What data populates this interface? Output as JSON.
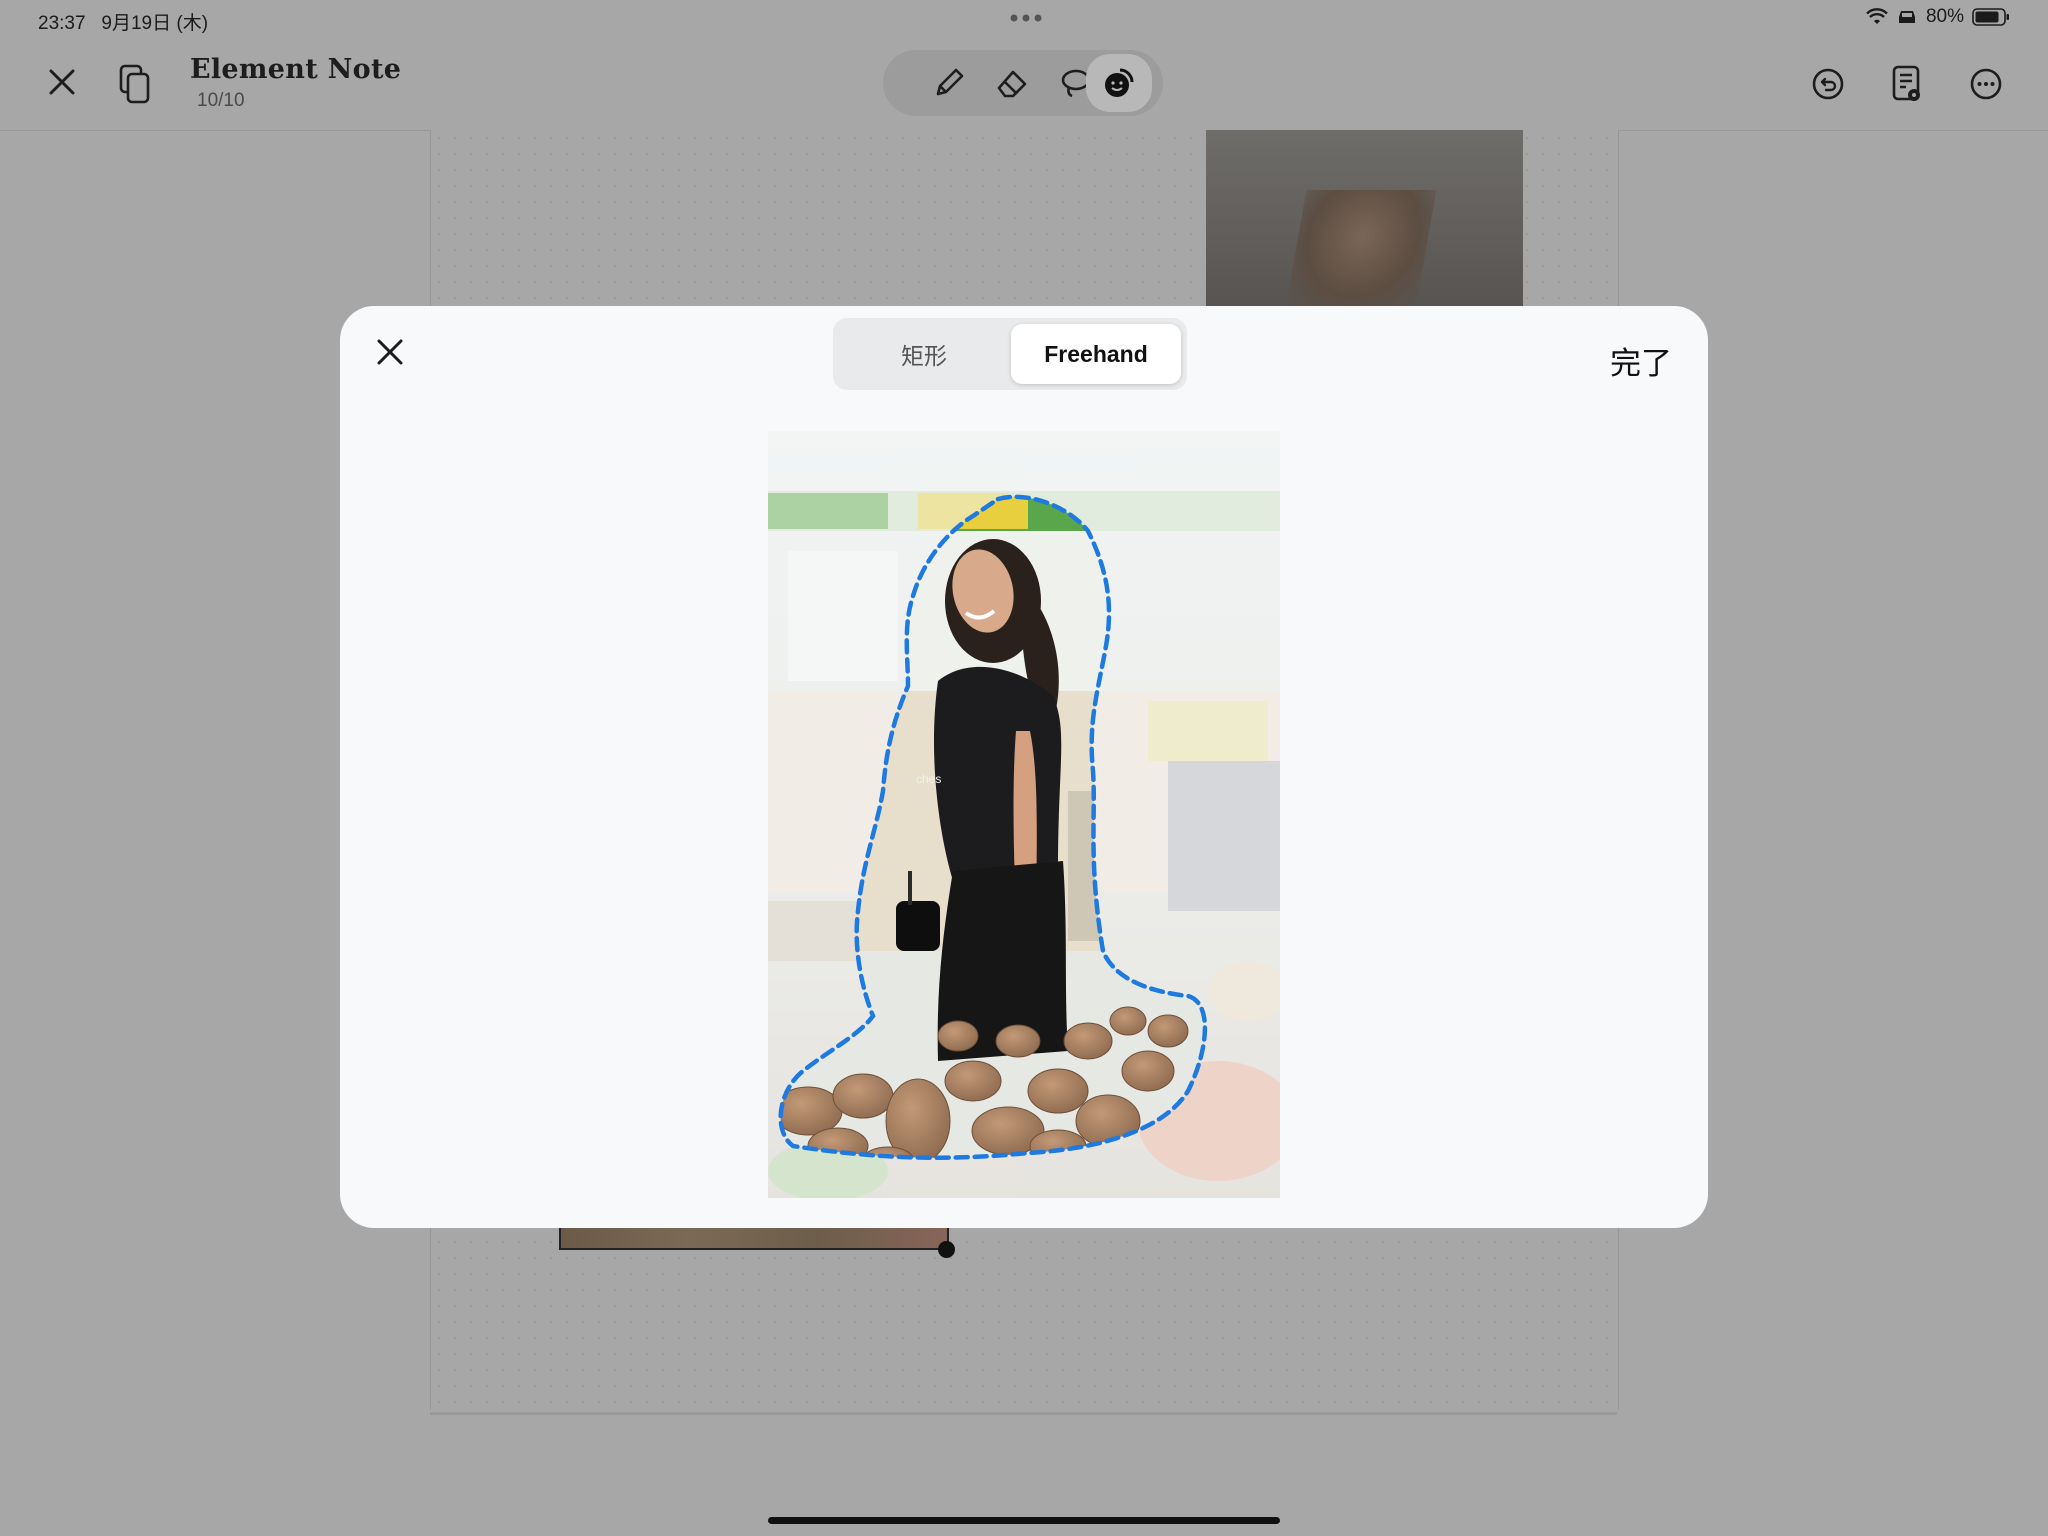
{
  "status_bar": {
    "time": "23:37",
    "date": "9月19日 (木)",
    "battery": "80%"
  },
  "document": {
    "title": "Element Note",
    "page": "10/10"
  },
  "toolbar": {
    "tools": [
      "pen-icon",
      "eraser-icon",
      "lasso-icon",
      "sticker-icon"
    ],
    "active_tool": "sticker-icon"
  },
  "modal": {
    "segments": [
      "矩形",
      "Freehand"
    ],
    "selected_segment": "Freehand",
    "done_label": "完了"
  },
  "colors": {
    "selection_outline": "#1f7ae0",
    "dimmed_background": "#a7a7a7",
    "modal_background": "#f8f9fb"
  }
}
